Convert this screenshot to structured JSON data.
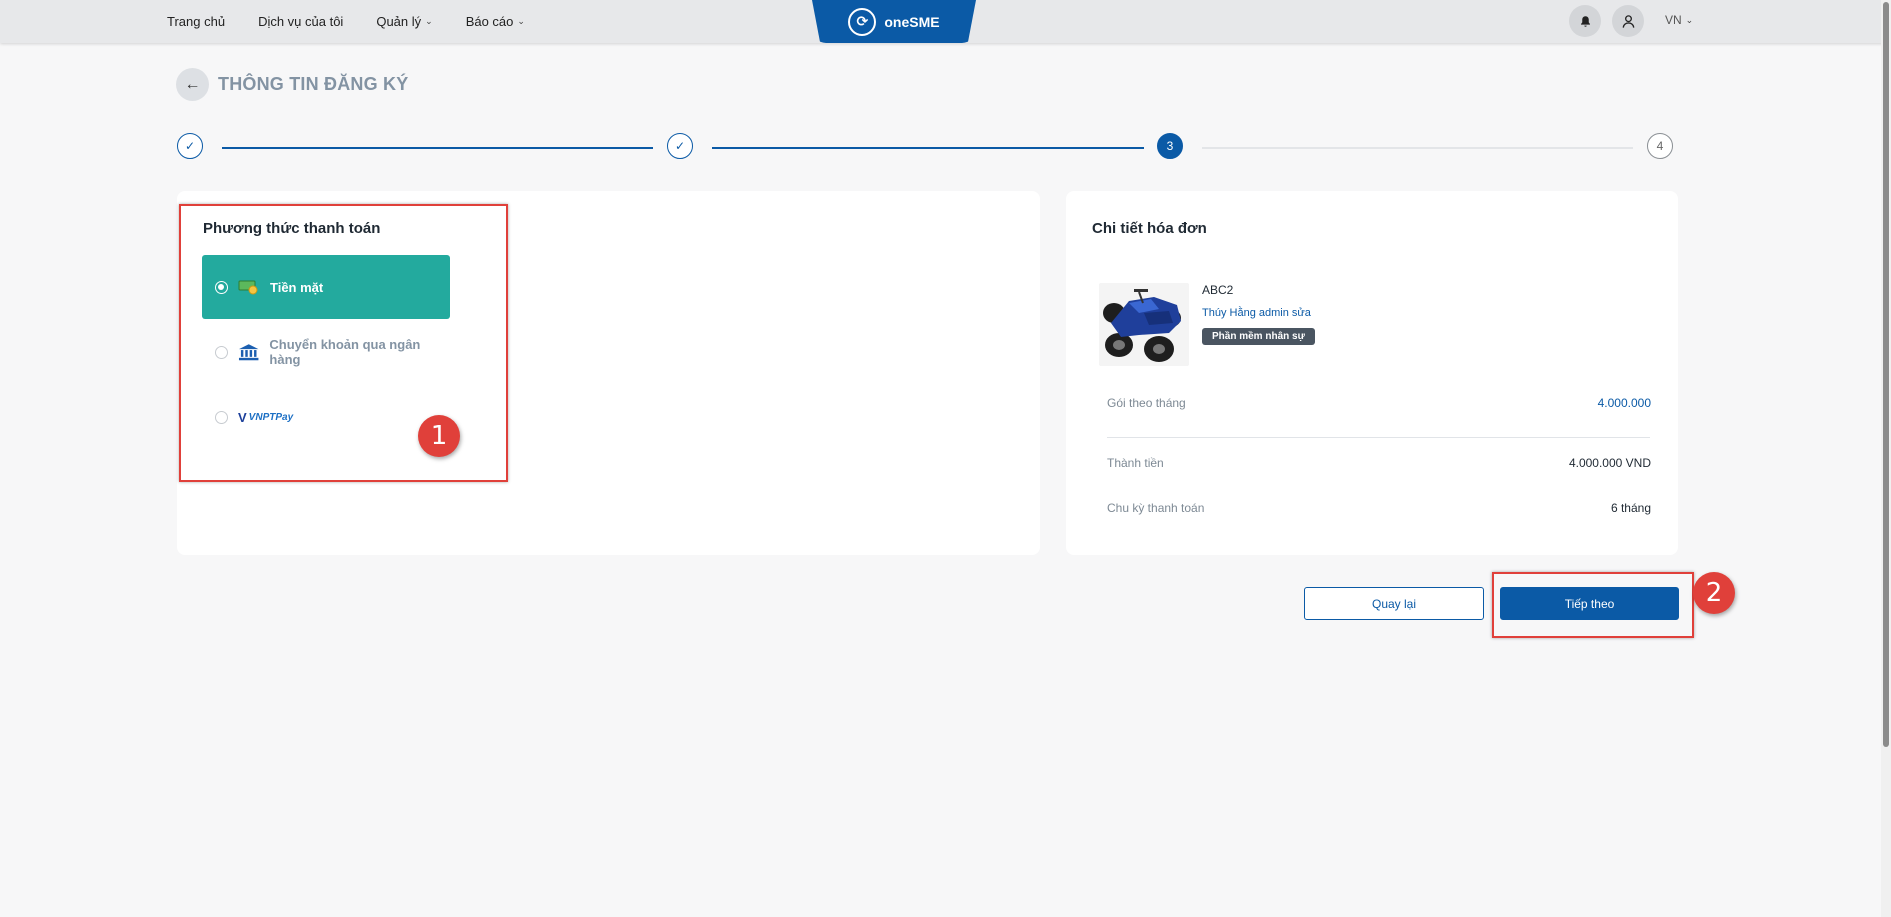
{
  "nav": {
    "items": [
      {
        "label": "Trang chủ",
        "has_dropdown": false
      },
      {
        "label": "Dịch vụ của tôi",
        "has_dropdown": false
      },
      {
        "label": "Quản lý",
        "has_dropdown": true
      },
      {
        "label": "Báo cáo",
        "has_dropdown": true
      }
    ],
    "brand": "oneSME",
    "language": "VN"
  },
  "page": {
    "title": "THÔNG TIN ĐĂNG KÝ"
  },
  "stepper": {
    "steps": [
      {
        "label": "✓",
        "state": "done"
      },
      {
        "label": "✓",
        "state": "done"
      },
      {
        "label": "3",
        "state": "active"
      },
      {
        "label": "4",
        "state": "todo"
      }
    ]
  },
  "payment": {
    "title": "Phương thức thanh toán",
    "options": [
      {
        "label": "Tiền mặt",
        "icon": "cash-icon",
        "selected": true
      },
      {
        "label": "Chuyển khoản qua ngân hàng",
        "icon": "bank-icon",
        "selected": false
      },
      {
        "label": "VNPTPay",
        "icon": "vnptpay-logo",
        "selected": false
      }
    ]
  },
  "invoice": {
    "title": "Chi tiết hóa đơn",
    "product": {
      "name": "ABC2",
      "vendor": "Thúy Hằng admin sửa",
      "tag": "Phần mềm nhân sự"
    },
    "rows": [
      {
        "label": "Gói theo tháng",
        "value": "4.000.000"
      },
      {
        "label": "Thành tiền",
        "value": "4.000.000 VND"
      },
      {
        "label": "Chu kỳ thanh toán",
        "value": "6 tháng"
      }
    ]
  },
  "actions": {
    "back_label": "Quay lại",
    "next_label": "Tiếp theo"
  },
  "annotations": {
    "one": "1",
    "two": "2"
  },
  "colors": {
    "primary": "#0b5aa6",
    "selected_option": "#23aa9e",
    "annotation": "#e0403a"
  }
}
